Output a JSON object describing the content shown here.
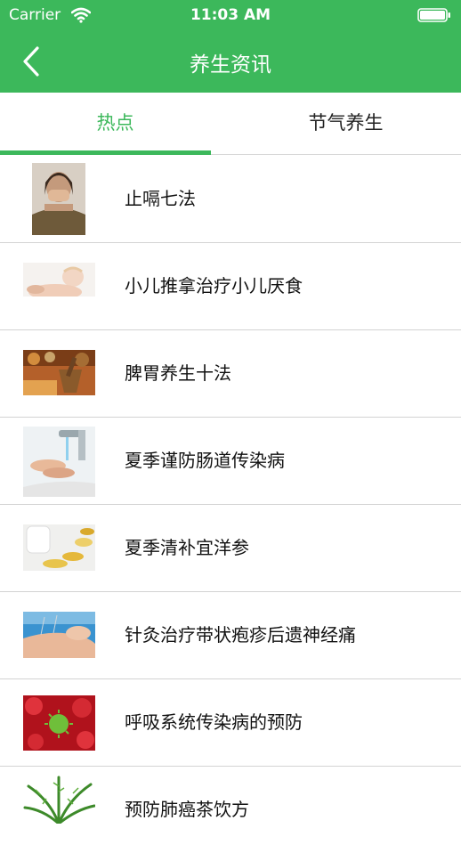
{
  "status_bar": {
    "carrier": "Carrier",
    "time": "11:03 AM"
  },
  "header": {
    "title": "养生资讯"
  },
  "tabs": [
    {
      "label": "热点",
      "active": true
    },
    {
      "label": "节气养生",
      "active": false
    }
  ],
  "colors": {
    "accent": "#3cb85b",
    "divider": "#d3d3d3"
  },
  "articles": [
    {
      "title": "止嗝七法",
      "image": "woman-covering-mouth"
    },
    {
      "title": "小儿推拿治疗小儿厌食",
      "image": "baby-massage"
    },
    {
      "title": "脾胃养生十法",
      "image": "herbs-mortar"
    },
    {
      "title": "夏季谨防肠道传染病",
      "image": "handwashing-faucet"
    },
    {
      "title": "夏季清补宜洋参",
      "image": "ginseng-capsules"
    },
    {
      "title": "针灸治疗带状疱疹后遗神经痛",
      "image": "acupuncture-hand"
    },
    {
      "title": "呼吸系统传染病的预防",
      "image": "virus-cells"
    },
    {
      "title": "预防肺癌茶饮方",
      "image": "fern-plant"
    }
  ]
}
